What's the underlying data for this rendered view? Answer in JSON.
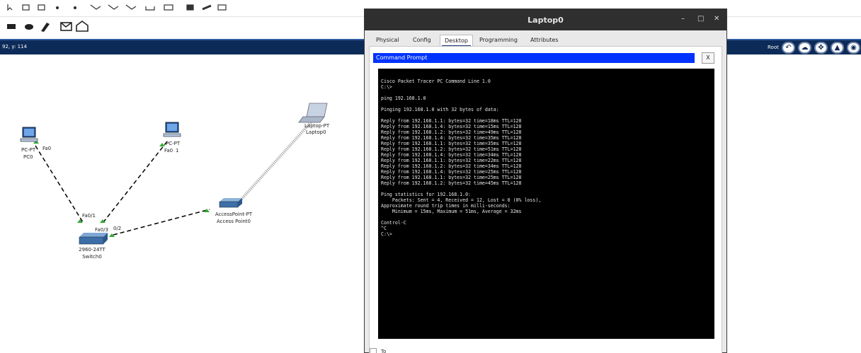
{
  "status": {
    "coords": "92, y: 114",
    "root_label": "Root"
  },
  "devices": {
    "pc0": {
      "model": "PC-PT",
      "name": "PC0",
      "port": "Fa0"
    },
    "pc1": {
      "model": "PC-PT",
      "port": "Fa0",
      "suffix": "1"
    },
    "laptop": {
      "model": "Laptop-PT",
      "name": "Laptop0"
    },
    "switch": {
      "model": "2960-24TT",
      "name": "Switch0",
      "port1": "Fa0/1",
      "port3": "Fa0/3",
      "port2": "0/2"
    },
    "ap": {
      "model": "AccessPoint-PT",
      "name": "Access Point0"
    }
  },
  "window": {
    "title": "Laptop0",
    "tabs": [
      "Physical",
      "Config",
      "Desktop",
      "Programming",
      "Attributes"
    ],
    "active_tab": "Desktop",
    "cmd_title": "Command Prompt",
    "close_label": "X"
  },
  "terminal": {
    "lines": [
      "Cisco Packet Tracer PC Command Line 1.0",
      "C:\\>",
      "",
      "ping 192.168.1.0",
      "",
      "Pinging 192.168.1.0 with 32 bytes of data:",
      "",
      "Reply from 192.168.1.1: bytes=32 time=18ms TTL=128",
      "Reply from 192.168.1.4: bytes=32 time=15ms TTL=128",
      "Reply from 192.168.1.2: bytes=32 time=49ms TTL=128",
      "Reply from 192.168.1.4: bytes=32 time=35ms TTL=128",
      "Reply from 192.168.1.1: bytes=32 time=35ms TTL=128",
      "Reply from 192.168.1.2: bytes=32 time=51ms TTL=128",
      "Reply from 192.168.1.4: bytes=32 time=34ms TTL=128",
      "Reply from 192.168.1.1: bytes=32 time=22ms TTL=128",
      "Reply from 192.168.1.2: bytes=32 time=34ms TTL=128",
      "Reply from 192.168.1.4: bytes=32 time=25ms TTL=128",
      "Reply from 192.168.1.1: bytes=32 time=25ms TTL=128",
      "Reply from 192.168.1.2: bytes=32 time=45ms TTL=128",
      "",
      "Ping statistics for 192.168.1.0:",
      "    Packets: Sent = 4, Received = 12, Lost = 0 (0% loss),",
      "Approximate round trip times in milli-seconds:",
      "    Minimum = 15ms, Maximum = 51ms, Average = 32ms",
      "",
      "Control-C",
      "^C",
      "C:\\>"
    ]
  },
  "colors": {
    "infobar": "#0d2b58",
    "cmd_header": "#0033ff",
    "link_port": "#33aa33"
  },
  "bottom_label": "To"
}
